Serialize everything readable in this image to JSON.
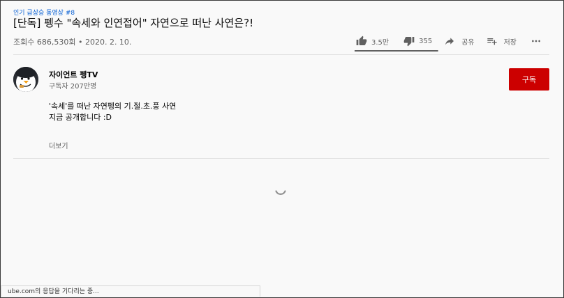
{
  "video": {
    "hashtag": "인기 급상승 동영상 #8",
    "title": "[단독] 펭수 \"속세와 인연접어\" 자연으로 떠난 사연은?!",
    "views": "조회수 686,530회",
    "separator": " • ",
    "date": "2020. 2. 10."
  },
  "actions": {
    "like_count": "3.5만",
    "dislike_count": "355",
    "share_label": "공유",
    "save_label": "저장",
    "like_ratio": 0.99
  },
  "channel": {
    "name": "자이언트 펭TV",
    "subscribers": "구독자 207만명",
    "subscribe_label": "구독"
  },
  "description": {
    "line1": "'속세'를 떠난 자연펭의 기.절.초.풍 사연",
    "line2": "지금 공개합니다 :D",
    "show_more": "더보기"
  },
  "status_bar": {
    "text": "ube.com의 응답을 기다리는 중..."
  },
  "colors": {
    "subscribe": "#cc0000",
    "link": "#065fd4",
    "secondary_text": "#606060"
  }
}
